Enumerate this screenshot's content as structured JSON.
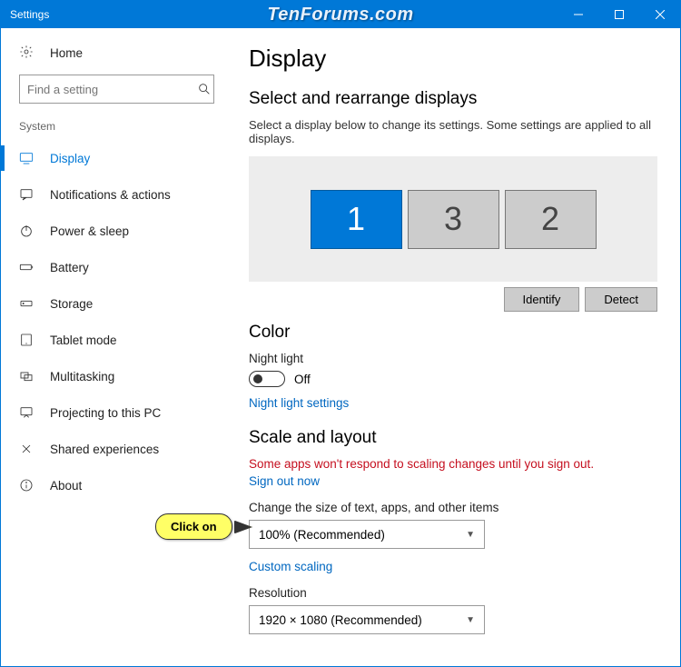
{
  "window": {
    "title": "Settings",
    "watermark": "TenForums.com"
  },
  "sidebar": {
    "home": "Home",
    "search_placeholder": "Find a setting",
    "group": "System",
    "items": [
      {
        "label": "Display",
        "active": true
      },
      {
        "label": "Notifications & actions"
      },
      {
        "label": "Power & sleep"
      },
      {
        "label": "Battery"
      },
      {
        "label": "Storage"
      },
      {
        "label": "Tablet mode"
      },
      {
        "label": "Multitasking"
      },
      {
        "label": "Projecting to this PC"
      },
      {
        "label": "Shared experiences"
      },
      {
        "label": "About"
      }
    ]
  },
  "main": {
    "title": "Display",
    "arrange": {
      "heading": "Select and rearrange displays",
      "help": "Select a display below to change its settings. Some settings are applied to all displays.",
      "displays": [
        "1",
        "3",
        "2"
      ],
      "selected_index": 0,
      "identify": "Identify",
      "detect": "Detect"
    },
    "color": {
      "heading": "Color",
      "night_light_label": "Night light",
      "toggle_state": "Off",
      "link": "Night light settings"
    },
    "scale": {
      "heading": "Scale and layout",
      "warning": "Some apps won't respond to scaling changes until you sign out.",
      "sign_out": "Sign out now",
      "size_label": "Change the size of text, apps, and other items",
      "size_value": "100% (Recommended)",
      "custom_link": "Custom scaling",
      "res_label": "Resolution",
      "res_value": "1920 × 1080 (Recommended)"
    }
  },
  "callout": {
    "text": "Click on"
  }
}
